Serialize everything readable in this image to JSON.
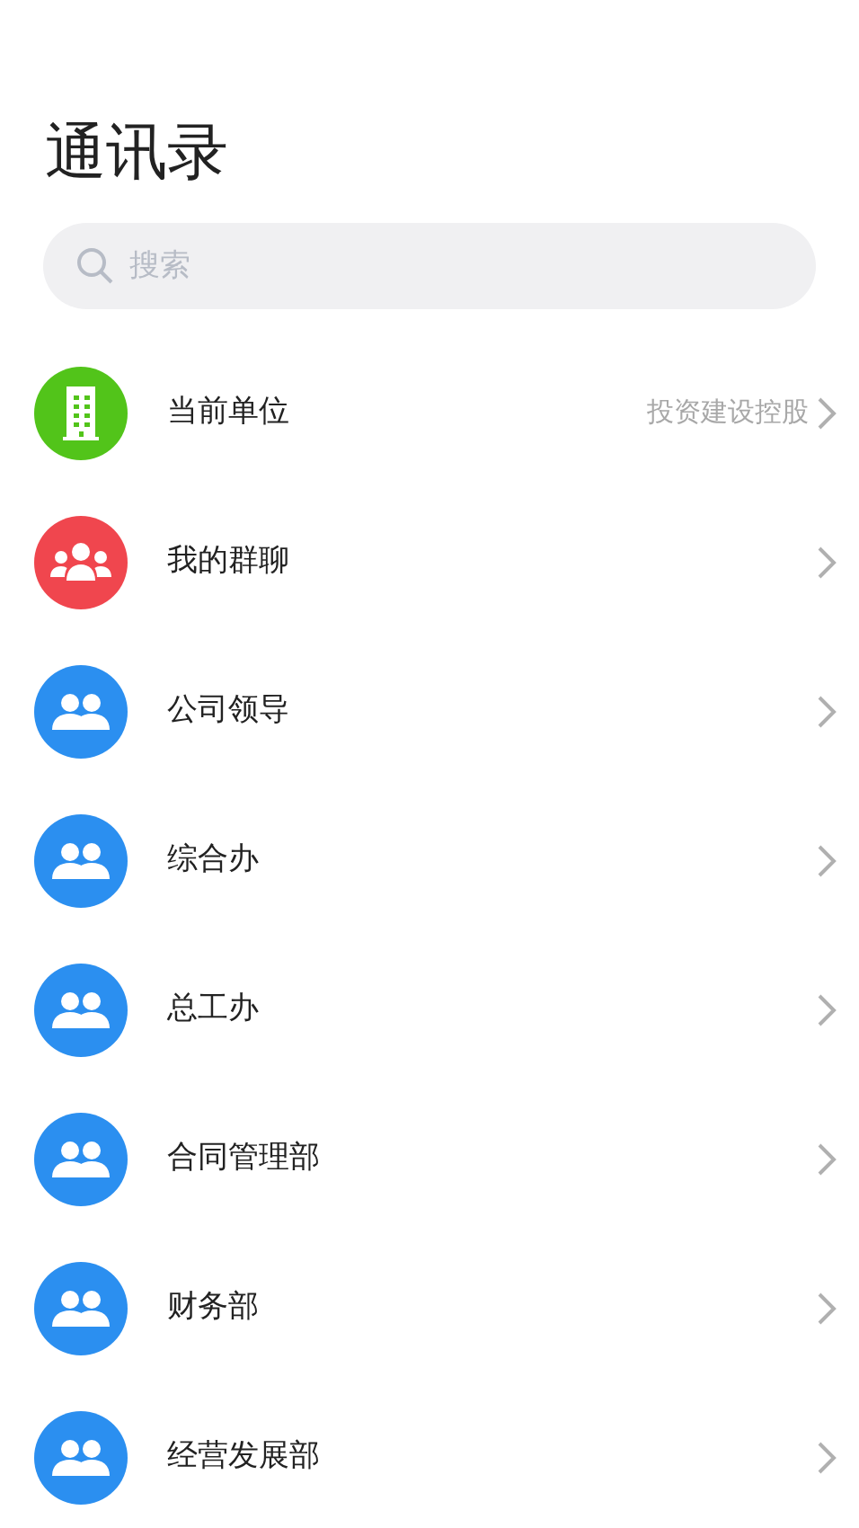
{
  "title": "通讯录",
  "search": {
    "placeholder": "搜索"
  },
  "items": [
    {
      "kind": "building",
      "color": "#52c41a",
      "label": "当前单位",
      "value": "投资建设控股"
    },
    {
      "kind": "group",
      "color": "#f0464e",
      "label": "我的群聊"
    },
    {
      "kind": "people",
      "color": "#2b8ff0",
      "label": "公司领导"
    },
    {
      "kind": "people",
      "color": "#2b8ff0",
      "label": "综合办"
    },
    {
      "kind": "people",
      "color": "#2b8ff0",
      "label": "总工办"
    },
    {
      "kind": "people",
      "color": "#2b8ff0",
      "label": "合同管理部"
    },
    {
      "kind": "people",
      "color": "#2b8ff0",
      "label": "财务部"
    },
    {
      "kind": "people",
      "color": "#2b8ff0",
      "label": "经营发展部"
    }
  ]
}
